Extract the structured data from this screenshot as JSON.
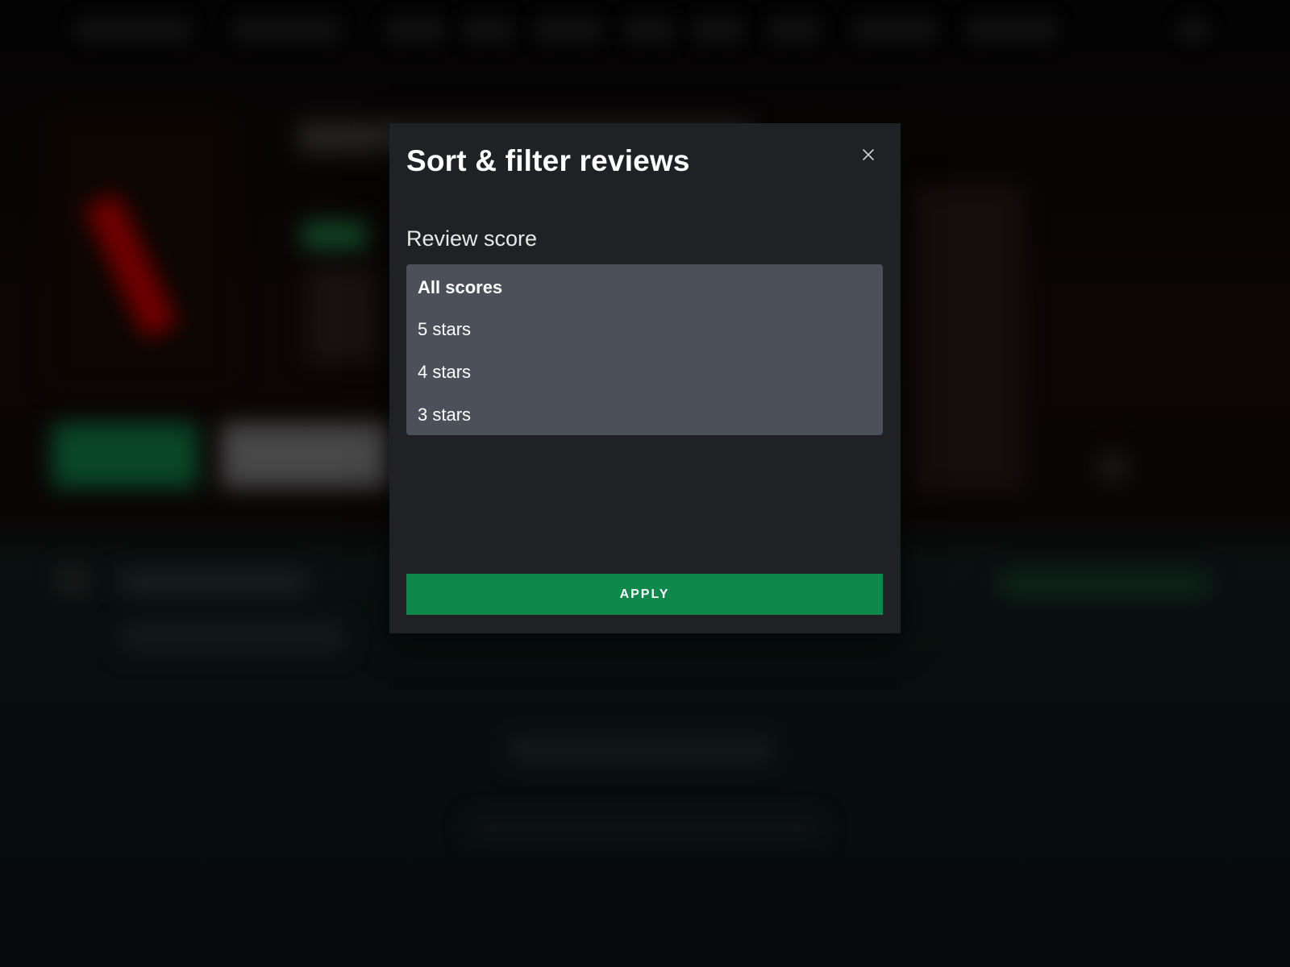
{
  "modal": {
    "title": "Sort & filter reviews",
    "close_icon": "close-icon",
    "section_label": "Review score",
    "options": [
      {
        "label": "All scores",
        "selected": true
      },
      {
        "label": "5 stars",
        "selected": false
      },
      {
        "label": "4 stars",
        "selected": false
      },
      {
        "label": "3 stars",
        "selected": false
      }
    ],
    "apply_label": "APPLY"
  },
  "colors": {
    "modal_bg": "#202125",
    "listbox_bg": "#4c5159",
    "apply_bg": "#0f884b",
    "text": "#ffffff"
  }
}
